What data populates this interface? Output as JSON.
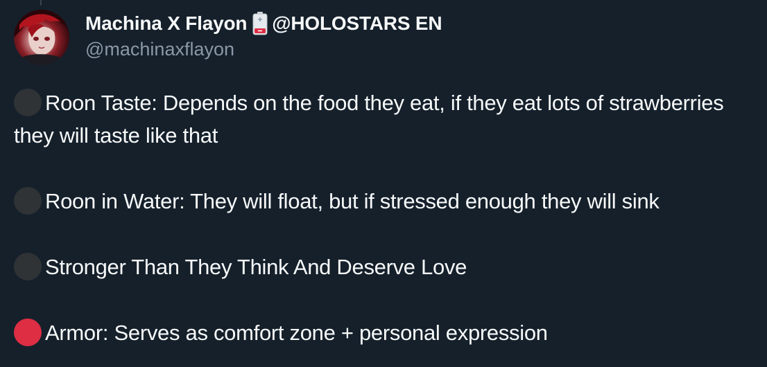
{
  "tweet": {
    "author": {
      "display_name": "Machina X Flayon",
      "badge_icon": "battery-icon",
      "name_suffix": "@HOLOSTARS EN",
      "handle": "@machinaxflayon"
    },
    "paragraphs": [
      {
        "bullet": "black-circle",
        "bullet_color": "#2f3336",
        "text": "Roon Taste: Depends on the food they eat, if they eat lots of strawberries they will taste like that"
      },
      {
        "bullet": "black-circle",
        "bullet_color": "#2f3336",
        "text": "Roon in Water: They will float, but if stressed enough they will sink"
      },
      {
        "bullet": "black-circle",
        "bullet_color": "#2f3336",
        "text": "Stronger Than They Think And Deserve Love"
      },
      {
        "bullet": "red-circle",
        "bullet_color": "#dd2e44",
        "text": "Armor: Serves as comfort zone + personal expression"
      }
    ]
  },
  "colors": {
    "background": "#15202b",
    "text_primary": "#f7f9f9",
    "text_secondary": "#8b98a5"
  }
}
